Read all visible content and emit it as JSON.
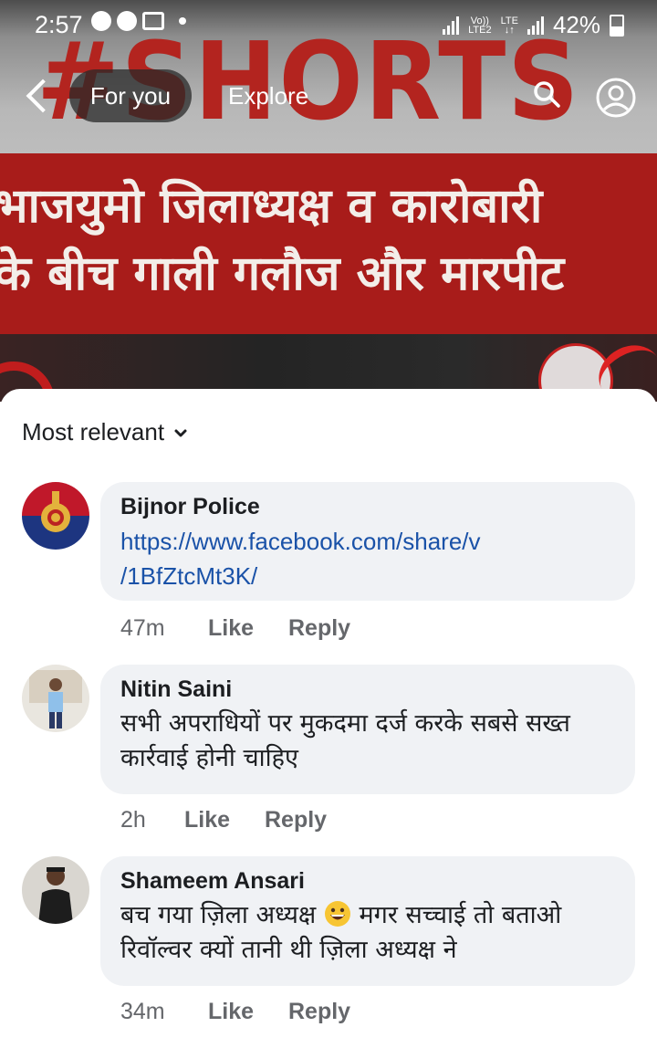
{
  "status_bar": {
    "time": "2:57",
    "volte": "Vo))",
    "lte2": "LTE2",
    "lte": "LTE",
    "battery": "42%"
  },
  "video": {
    "shorts_text": "#SHORTS",
    "headline_line1": "भाजयुमो जिलाध्यक्ष व कारोबारी",
    "headline_line2": "के बीच गाली गलौज और मारपीट"
  },
  "nav": {
    "for_you": "For you",
    "explore": "Explore"
  },
  "sort": {
    "label": "Most relevant"
  },
  "comments": [
    {
      "author": "Bijnor Police",
      "link_line1": "https://www.facebook.com/share/v",
      "link_line2": "/1BfZtcMt3K/",
      "time": "47m",
      "like": "Like",
      "reply": "Reply"
    },
    {
      "author": "Nitin Saini",
      "text_line1": "सभी अपराधियों पर मुकदमा दर्ज करके सबसे सख्त",
      "text_line2": "कार्रवाई होनी चाहिए",
      "time": "2h",
      "like": "Like",
      "reply": "Reply"
    },
    {
      "author": "Shameem Ansari",
      "text_line1a": "बच गया ज़िला अध्यक्ष",
      "text_line1b": "मगर सच्चाई तो बताओ",
      "text_line2": "रिवॉल्वर क्यों तानी थी ज़िला अध्यक्ष ने",
      "time": "34m",
      "like": "Like",
      "reply": "Reply"
    }
  ]
}
